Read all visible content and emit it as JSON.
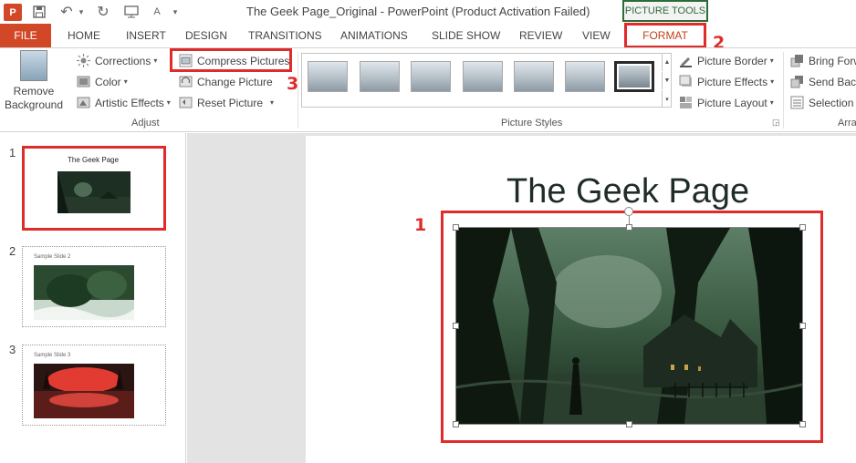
{
  "titlebar": {
    "app_icon": "P",
    "title": "The Geek Page_Original - PowerPoint (Product Activation Failed)",
    "context_label": "PICTURE TOOLS",
    "font_icon_text": "A",
    "icons": [
      "powerpoint-app-icon",
      "save-icon",
      "undo-icon",
      "redo-icon",
      "start-from-beginning-icon",
      "font-color-icon"
    ]
  },
  "tabs": [
    "FILE",
    "HOME",
    "INSERT",
    "DESIGN",
    "TRANSITIONS",
    "ANIMATIONS",
    "SLIDE SHOW",
    "REVIEW",
    "VIEW",
    "FORMAT"
  ],
  "ribbon": {
    "adjust": {
      "remove_bg_line1": "Remove",
      "remove_bg_line2": "Background",
      "corrections": "Corrections",
      "color": "Color",
      "artistic_effects": "Artistic Effects",
      "compress": "Compress Pictures",
      "change": "Change Picture",
      "reset": "Reset Picture",
      "group_label": "Adjust"
    },
    "picture_styles": {
      "group_label": "Picture Styles",
      "border": "Picture Border",
      "effects": "Picture Effects",
      "layout": "Picture Layout"
    },
    "arrange": {
      "group_label": "Arra",
      "bring_forward": "Bring Forw",
      "send_backward": "Send Back",
      "selection": "Selection I"
    }
  },
  "slides": [
    {
      "number": "1",
      "title": "The Geek Page"
    },
    {
      "number": "2",
      "title": "Sample Slide 2"
    },
    {
      "number": "3",
      "title": "Sample Slide 3"
    }
  ],
  "main_slide": {
    "title": "The Geek Page"
  },
  "annotations": {
    "step1": "1",
    "step2": "2",
    "step3": "3"
  },
  "colors": {
    "accent": "#d24726",
    "highlight": "#e02b2b",
    "picture_tools": "#2e6b39"
  }
}
